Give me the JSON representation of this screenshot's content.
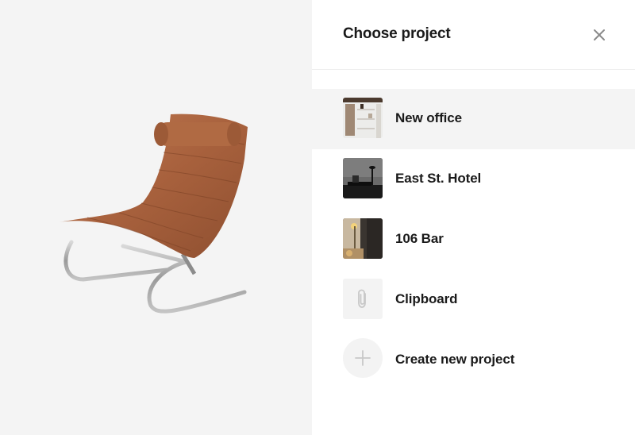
{
  "dialog": {
    "title": "Choose project",
    "close_icon": "close-icon"
  },
  "product": {
    "image": "leather-lounge-chair"
  },
  "projects": [
    {
      "label": "New office",
      "thumbnail": "office-shelf-photo",
      "selected": true
    },
    {
      "label": "East St. Hotel",
      "thumbnail": "hotel-lamp-photo",
      "selected": false
    },
    {
      "label": "106 Bar",
      "thumbnail": "bar-lamp-photo",
      "selected": false
    },
    {
      "label": "Clipboard",
      "thumbnail": "paperclip-icon",
      "selected": false
    },
    {
      "label": "Create new project",
      "thumbnail": "plus-icon",
      "selected": false
    }
  ],
  "colors": {
    "selected_row": "#f4f4f4",
    "icon_gray": "#c8c8c8",
    "text": "#1a1a1a"
  }
}
